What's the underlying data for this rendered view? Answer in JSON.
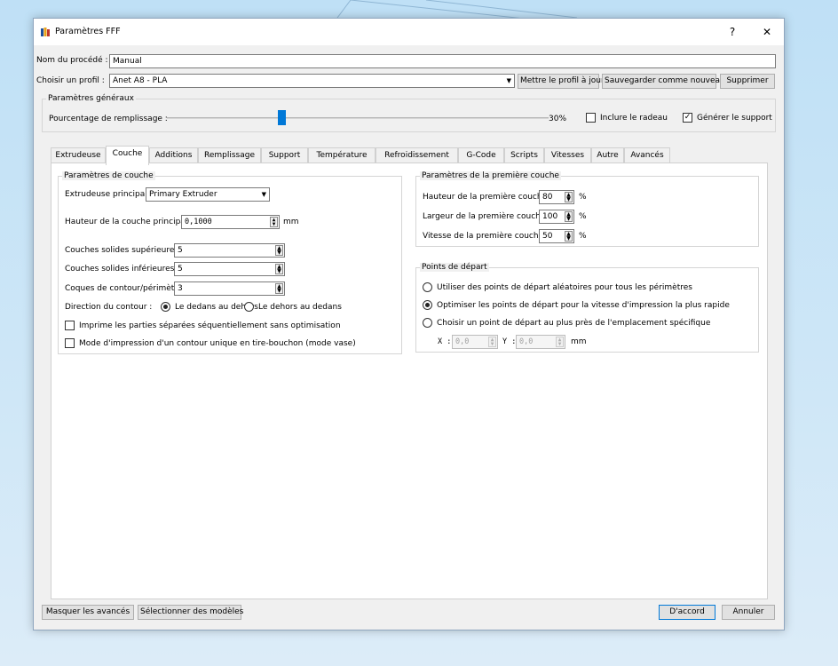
{
  "window": {
    "title": "Paramètres FFF",
    "help_glyph": "?",
    "close_glyph": "✕"
  },
  "process": {
    "label": "Nom du procédé :",
    "value": "Manual"
  },
  "profile": {
    "label": "Choisir un profil :",
    "value": "Anet A8 - PLA",
    "update_button": "Mettre le profil à jour",
    "save_new_button": "Sauvegarder comme nouveau",
    "delete_button": "Supprimer"
  },
  "general": {
    "title": "Paramètres généraux",
    "infill_label": "Pourcentage de remplissage :",
    "infill_value": "30%",
    "infill_fraction": 0.3,
    "raft_label": "Inclure le radeau",
    "raft_checked": false,
    "support_label": "Générer le support",
    "support_checked": true
  },
  "tabs": [
    "Extrudeuse",
    "Couche",
    "Additions",
    "Remplissage",
    "Support",
    "Température",
    "Refroidissement",
    "G-Code",
    "Scripts",
    "Vitesses",
    "Autre",
    "Avancés"
  ],
  "active_tab": "Couche",
  "layer": {
    "title": "Paramètres de couche",
    "extruder_label": "Extrudeuse principale",
    "extruder_value": "Primary Extruder",
    "height_label": "Hauteur de la couche principale",
    "height_value": "0,1000",
    "height_unit": "mm",
    "top_label": "Couches solides supérieures",
    "top_value": "5",
    "bottom_label": "Couches solides inférieures",
    "bottom_value": "5",
    "shells_label": "Coques de contour/périmètre",
    "shells_value": "3",
    "direction_label": "Direction du contour :",
    "direction_in_out": "Le dedans au dehors",
    "direction_out_in": "Le dehors au dedans",
    "sequential_label": "Imprime les parties séparées séquentiellement sans optimisation",
    "vase_label": "Mode d'impression d'un contour unique en tire-bouchon (mode vase)"
  },
  "first_layer": {
    "title": "Paramètres de la première couche",
    "height_label": "Hauteur de la première couche",
    "height_value": "80",
    "width_label": "Largeur de la première couche",
    "width_value": "100",
    "speed_label": "Vitesse de la première couche",
    "speed_value": "50",
    "unit": "%"
  },
  "start_points": {
    "title": "Points de départ",
    "option_random": "Utiliser des points de départ aléatoires pour tous les périmètres",
    "option_optimize": "Optimiser les points de départ pour la vitesse d'impression la plus rapide",
    "option_specific": "Choisir un point de départ au plus près de l'emplacement spécifique",
    "x_label": "X :",
    "x_value": "0,0",
    "y_label": "Y :",
    "y_value": "0,0",
    "unit": "mm"
  },
  "footer": {
    "hide_advanced": "Masquer les avancés",
    "select_models": "Sélectionner des modèles",
    "ok": "D'accord",
    "cancel": "Annuler"
  },
  "colors": {
    "accent": "#0078d7",
    "window_bg": "#f0f0f0",
    "desktop": "#cfe7f7"
  }
}
